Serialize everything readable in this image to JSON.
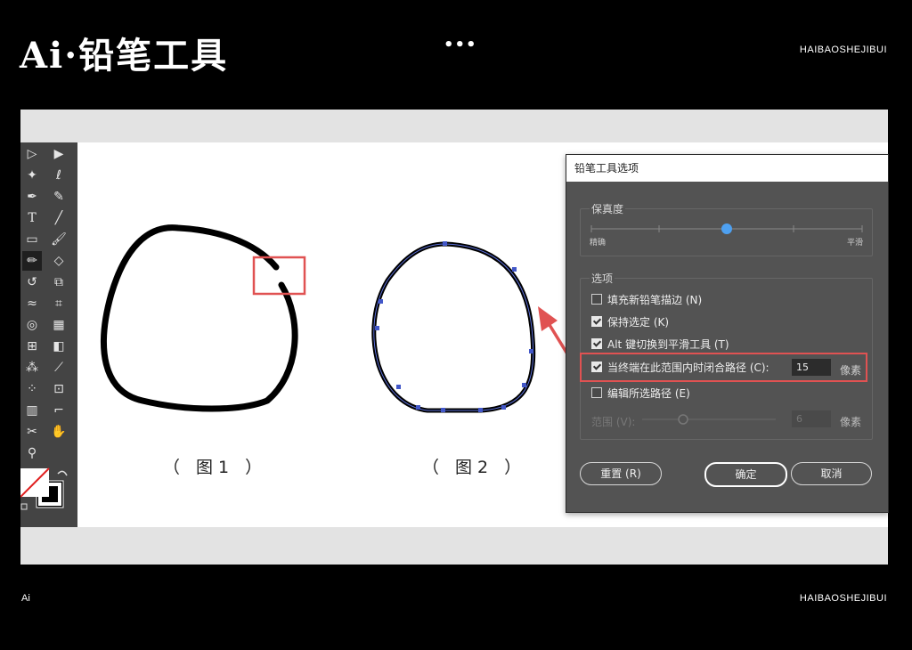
{
  "header": {
    "title": "Ai·铅笔工具",
    "dots": "•••",
    "brand": "HAIBAOSHEJIBUI"
  },
  "footer": {
    "left": "Ai",
    "brand": "HAIBAOSHEJIBUI"
  },
  "figures": {
    "fig1": "（ 图1 ）",
    "fig2": "（ 图2 ）"
  },
  "dialog": {
    "title": "铅笔工具选项",
    "fidelity": {
      "label": "保真度",
      "left": "精确",
      "right": "平滑",
      "value": 0.5
    },
    "options_label": "选项",
    "options": [
      {
        "label": "填充新铅笔描边 (N)",
        "checked": false
      },
      {
        "label": "保持选定 (K)",
        "checked": true
      },
      {
        "label": "Alt 键切换到平滑工具 (T)",
        "checked": true
      },
      {
        "label": "当终端在此范围内时闭合路径 (C):",
        "checked": true
      },
      {
        "label": "编辑所选路径 (E)",
        "checked": false
      }
    ],
    "close_value": "15",
    "close_unit": "像素",
    "range": {
      "label": "范围 (V):",
      "value": "6",
      "unit": "像素"
    },
    "buttons": {
      "reset": "重置 (R)",
      "ok": "确定",
      "cancel": "取消"
    }
  },
  "colors": {
    "highlight": "#e05252",
    "slider_knob": "#4ea0f0",
    "toolbar": "#444444",
    "dialog": "#535353"
  }
}
